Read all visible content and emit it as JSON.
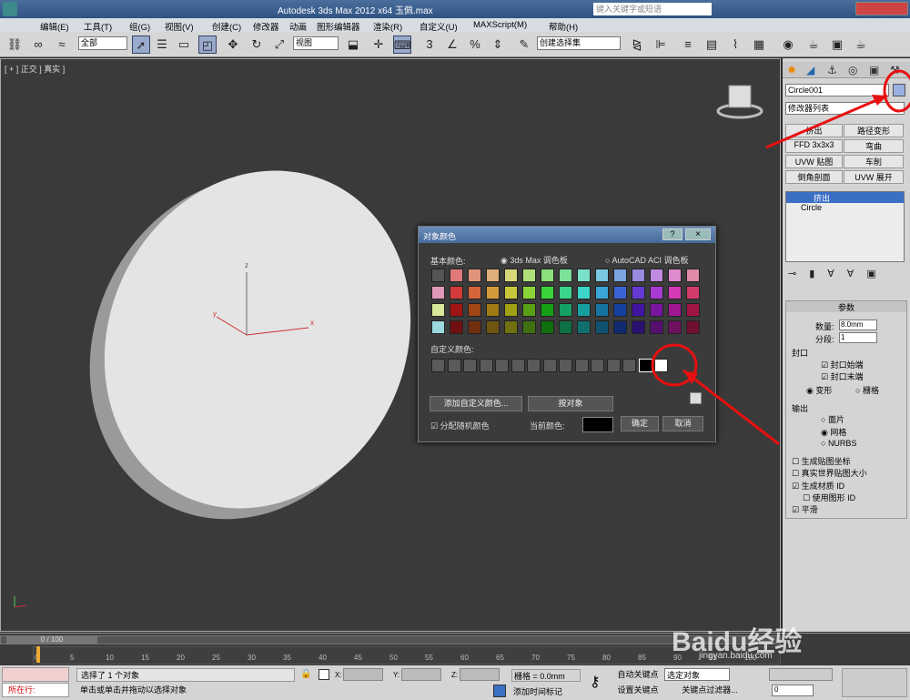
{
  "titlebar": {
    "title": "Autodesk 3ds Max  2012 x64     玉佩.max",
    "search_placeholder": "键入关键字或短语"
  },
  "menu": [
    "编辑(E)",
    "工具(T)",
    "组(G)",
    "视图(V)",
    "创建(C)",
    "修改器",
    "动画",
    "图形编辑器",
    "渲染(R)",
    "自定义(U)",
    "MAXScript(M)",
    "帮助(H)"
  ],
  "toolbar": {
    "filter": "全部",
    "view": "视图",
    "selection_set": "创建选择集"
  },
  "viewport": {
    "label": "[ + ] 正交 ] 真实 ]",
    "axis_x": "x",
    "axis_y": "y",
    "axis_z": "z"
  },
  "command_panel": {
    "object_name": "Circle001",
    "modifier_list": "修改器列表",
    "buttons": [
      "挤出",
      "路径变形",
      "FFD 3x3x3",
      "弯曲",
      "UVW 贴图",
      "车削",
      "倒角剖面",
      "UVW 展开"
    ],
    "stack": [
      "挤出",
      "Circle"
    ],
    "params_title": "参数",
    "amount_label": "数量:",
    "amount": "8.0mm",
    "segments_label": "分段:",
    "segments": "1",
    "cap_title": "封口",
    "cap_start": "封口始端",
    "cap_end": "封口末端",
    "morph": "变形",
    "grid": "栅格",
    "output_title": "输出",
    "patch": "面片",
    "mesh": "网格",
    "nurbs": "NURBS",
    "gen_map": "生成贴图坐标",
    "real_world": "真实世界贴图大小",
    "gen_mat": "生成材质 ID",
    "use_shape": "使用图形 ID",
    "smooth": "平滑"
  },
  "dialog": {
    "title": "对象颜色",
    "help": "?",
    "close": "×",
    "basic_colors": "基本颜色:",
    "palette_max": "3ds Max 调色板",
    "palette_acad": "AutoCAD ACI 调色板",
    "custom_colors": "自定义颜色:",
    "add_custom": "添加自定义颜色...",
    "by_object": "按对象",
    "random": "分配随机颜色",
    "current": "当前颜色:",
    "ok": "确定",
    "cancel": "取消",
    "swatches": [
      [
        "#555555",
        "#e07a7a",
        "#e0957a",
        "#e0b07a",
        "#d8d87a",
        "#b0e07a",
        "#8ae07a",
        "#7ae09a",
        "#7ae0c8",
        "#7ac8e0",
        "#7aa5e0",
        "#9a8ae0",
        "#c08ae0",
        "#e08ad0",
        "#e08aaa"
      ],
      [
        "#e099b8",
        "#d43a3a",
        "#d4643a",
        "#d49a3a",
        "#c8c83a",
        "#8ad43a",
        "#3ad43a",
        "#3ad48a",
        "#3ad4c8",
        "#3aa5d4",
        "#3a64d4",
        "#643ad4",
        "#aa3ad4",
        "#d43ab8",
        "#d43a6a"
      ],
      [
        "#d8e89a",
        "#a01515",
        "#a04515",
        "#a07a15",
        "#a0a015",
        "#5aa015",
        "#15a015",
        "#15a064",
        "#15a0a0",
        "#1575a0",
        "#1540a0",
        "#4015a0",
        "#7a15a0",
        "#a01590",
        "#a01545"
      ],
      [
        "#9ad8e0",
        "#701010",
        "#703010",
        "#705510",
        "#707010",
        "#407010",
        "#107010",
        "#107045",
        "#107070",
        "#105070",
        "#102a70",
        "#2a1070",
        "#551070",
        "#701060",
        "#701030"
      ]
    ]
  },
  "timeline": {
    "frame": "0 / 100",
    "ticks": [
      "0",
      "5",
      "10",
      "15",
      "20",
      "25",
      "30",
      "35",
      "40",
      "45",
      "50",
      "55",
      "60",
      "65",
      "70",
      "75",
      "80",
      "85",
      "90",
      "95",
      "100"
    ]
  },
  "status": {
    "mini": "所在行:",
    "selected": "选择了 1 个对象",
    "prompt": "单击或单击并拖动以选择对象",
    "x": "X:",
    "y": "Y:",
    "z": "Z:",
    "grid": "栅格 = 0.0mm",
    "autokey": "自动关键点",
    "selected_obj": "选定对象",
    "setkey": "设置关键点",
    "key_filter": "关键点过滤器...",
    "add_time_tag": "添加时间标记",
    "frame_value": "0"
  },
  "watermark": "Baidu经验",
  "watermark_sub": "jingyan.baidu.com",
  "colors": {
    "accent": "#e81010",
    "title_blue": "#2f5283"
  }
}
